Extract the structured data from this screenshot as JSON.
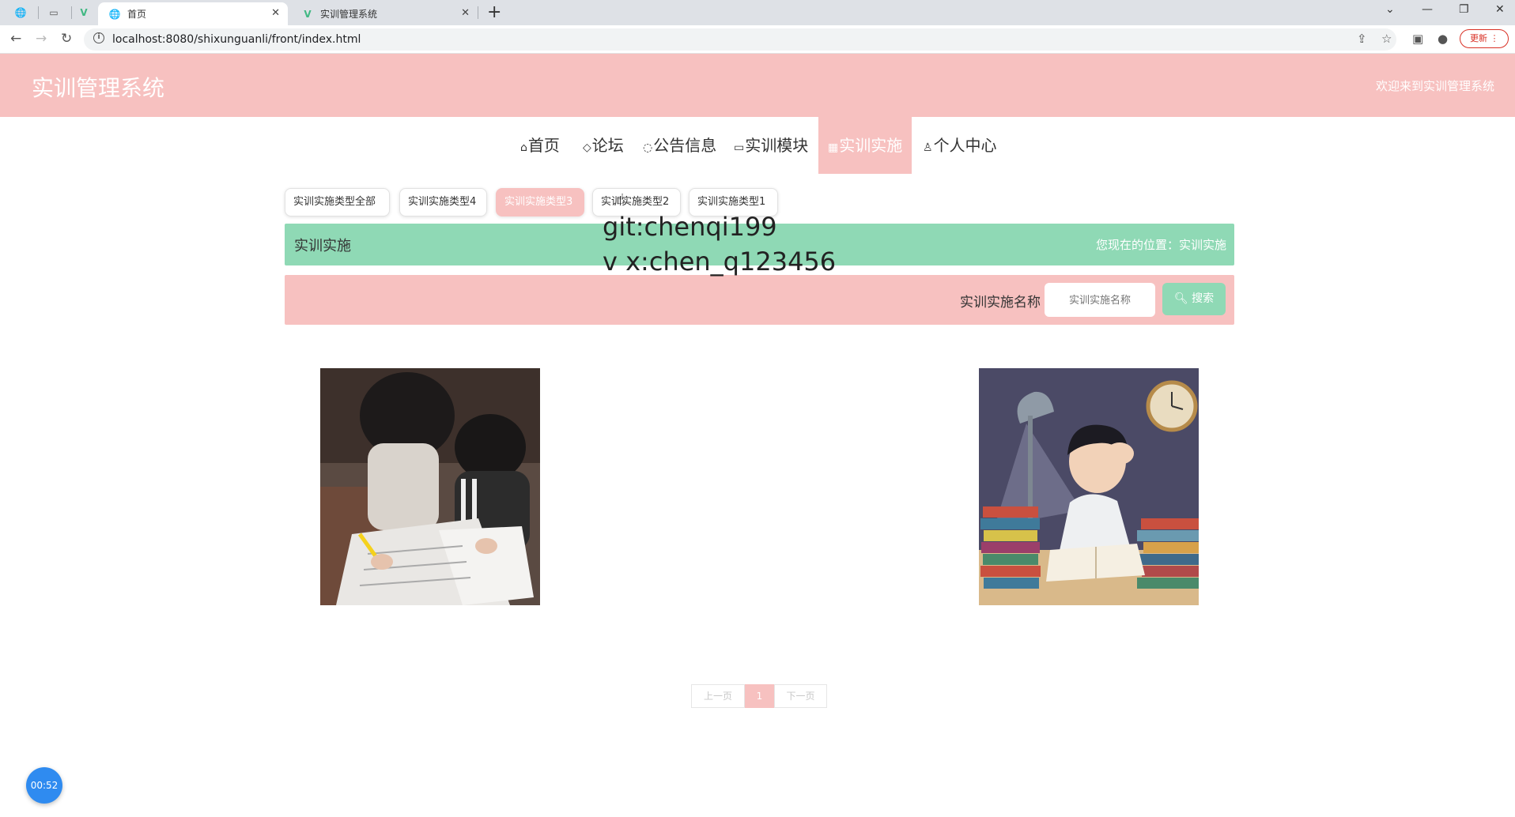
{
  "browser": {
    "tabs": [
      {
        "title": "首页",
        "active": true
      },
      {
        "title": "实训管理系统",
        "active": false
      }
    ],
    "url": "localhost:8080/shixunguanli/front/index.html",
    "update_label": "更新"
  },
  "header": {
    "site_title": "实训管理系统",
    "welcome": "欢迎来到实训管理系统"
  },
  "menu": {
    "items": [
      {
        "label": "首页",
        "icon": "home-icon",
        "glyph": "⌂",
        "active": false
      },
      {
        "label": "论坛",
        "icon": "tag-icon",
        "glyph": "◇",
        "active": false
      },
      {
        "label": "公告信息",
        "icon": "notice-icon",
        "glyph": "◌",
        "active": false
      },
      {
        "label": "实训模块",
        "icon": "book-icon",
        "glyph": "▭",
        "active": false
      },
      {
        "label": "实训实施",
        "icon": "grid-icon",
        "glyph": "▦",
        "active": true
      },
      {
        "label": "个人中心",
        "icon": "user-icon",
        "glyph": "♙",
        "active": false
      }
    ]
  },
  "categories": [
    {
      "label": "实训实施类型全部",
      "active": false
    },
    {
      "label": "实训实施类型4",
      "active": false
    },
    {
      "label": "实训实施类型3",
      "active": true
    },
    {
      "label": "实训实施类型2",
      "active": false
    },
    {
      "label": "实训实施类型1",
      "active": false
    }
  ],
  "breadcrumb": {
    "title": "实训实施",
    "position": "您现在的位置：实训实施"
  },
  "search": {
    "label": "实训实施名称",
    "placeholder": "实训实施名称",
    "button": "搜索"
  },
  "watermark": {
    "line1": "git:chenqi199",
    "line2": "v x:chen_q123456"
  },
  "pagination": {
    "prev": "上一页",
    "current": "1",
    "next": "下一页"
  },
  "timer": "00:52",
  "colors": {
    "pink": "#f7c1c0",
    "green": "#8fd9b5"
  }
}
